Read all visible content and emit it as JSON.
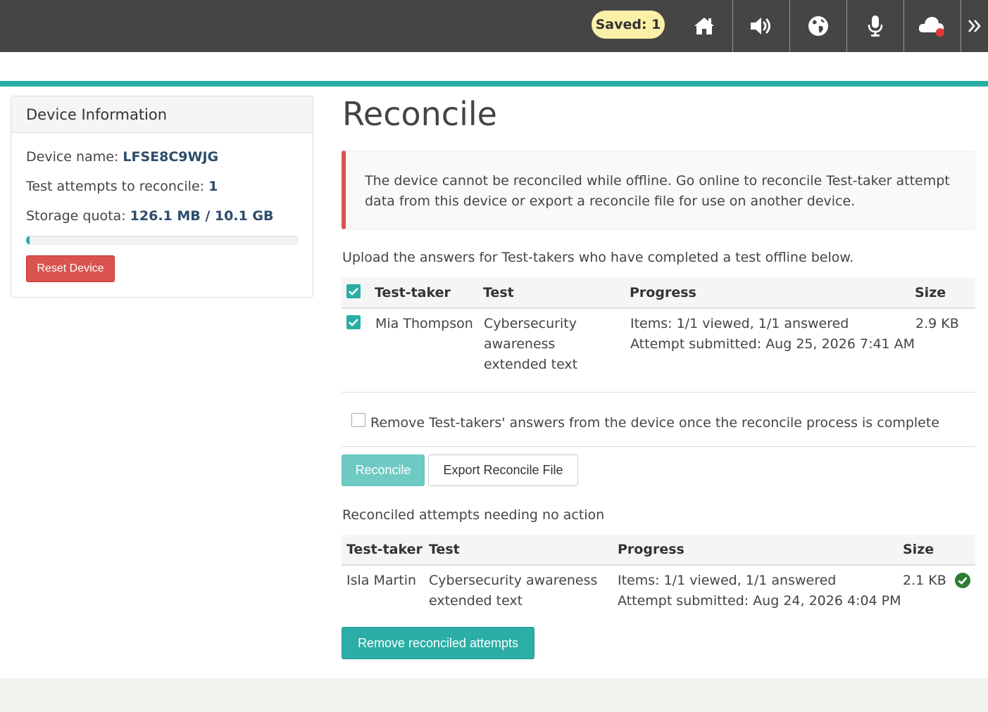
{
  "topbar": {
    "saved_label": "Saved: 1",
    "icons": [
      "home-icon",
      "volume-icon",
      "globe-icon",
      "microphone-icon",
      "cloud-offline-icon",
      "chevrons-right-icon"
    ]
  },
  "sidebar": {
    "title": "Device Information",
    "device_name_label": "Device name:",
    "device_name_value": "LFSE8C9WJG",
    "attempts_label": "Test attempts to reconcile:",
    "attempts_value": "1",
    "storage_label": "Storage quota:",
    "storage_value": "126.1 MB / 10.1 GB",
    "storage_fraction": 0.012,
    "reset_label": "Reset Device"
  },
  "main": {
    "title": "Reconcile",
    "alert": "The device cannot be reconciled while offline. Go online to reconcile Test-taker attempt data from this device or export a reconcile file for use on another device.",
    "upload_text": "Upload the answers for Test-takers who have completed a test offline below.",
    "pending_table": {
      "headers": [
        "Test-taker",
        "Test",
        "Progress",
        "Size"
      ],
      "rows": [
        {
          "name": "Mia Thompson",
          "test": "Cybersecurity awareness extended text",
          "progress_items": "Items: 1/1 viewed, 1/1 answered",
          "progress_submitted": "Attempt submitted: Aug 25, 2026 7:41 AM",
          "size": "2.9 KB",
          "checked": true
        }
      ]
    },
    "remove_option": "Remove Test-takers' answers from the device once the reconcile process is complete",
    "reconcile_label": "Reconcile",
    "export_label": "Export Reconcile File",
    "reconciled_heading": "Reconciled attempts needing no action",
    "reconciled_table": {
      "headers": [
        "Test-taker",
        "Test",
        "Progress",
        "Size"
      ],
      "rows": [
        {
          "name": "Isla Martin",
          "test": "Cybersecurity awareness extended text",
          "progress_items": "Items: 1/1 viewed, 1/1 answered",
          "progress_submitted": "Attempt submitted: Aug 24, 2026 4:04 PM",
          "size": "2.1 KB"
        }
      ]
    },
    "remove_reconciled_label": "Remove reconciled attempts"
  },
  "colors": {
    "accent": "#2aaea5",
    "danger": "#d9534f",
    "topbar": "#454545",
    "badge": "#faf0a8",
    "success": "#2e7d32"
  }
}
